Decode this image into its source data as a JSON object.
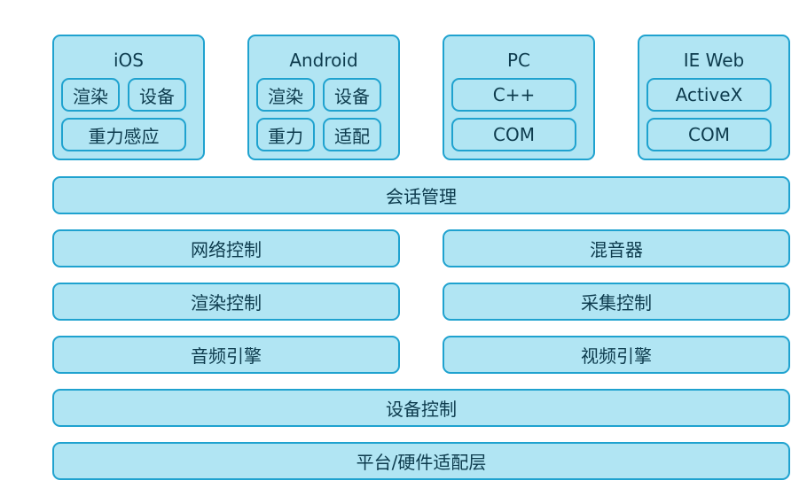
{
  "diagram_title": "",
  "colors": {
    "box_fill": "#b1e5f3",
    "box_border": "#1fa2cf",
    "text": "#0d3b4d"
  },
  "platforms": [
    {
      "title": "iOS",
      "modules": [
        "渲染",
        "设备",
        "重力感应"
      ]
    },
    {
      "title": "Android",
      "modules": [
        "渲染",
        "设备",
        "重力",
        "适配"
      ]
    },
    {
      "title": "PC",
      "modules": [
        "C++",
        "COM"
      ]
    },
    {
      "title": "IE Web",
      "modules": [
        "ActiveX",
        "COM"
      ]
    }
  ],
  "layers": {
    "session": "会话管理",
    "network_control": "网络控制",
    "mixer": "混音器",
    "render_control": "渲染控制",
    "capture_control": "采集控制",
    "audio_engine": "音频引擎",
    "video_engine": "视频引擎",
    "device_control": "设备控制",
    "platform_hardware_adapter": "平台/硬件适配层"
  }
}
